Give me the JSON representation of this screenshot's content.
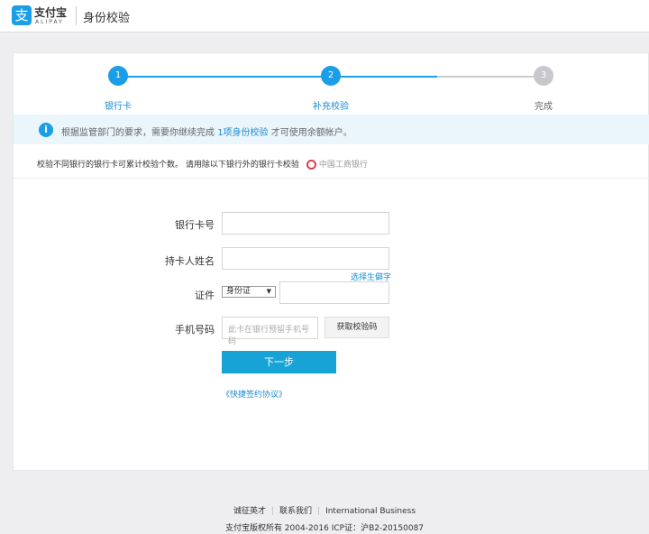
{
  "header": {
    "logo_glyph": "支",
    "logo_name": "支付宝",
    "logo_sub": "ALIPAY",
    "title": "身份校验"
  },
  "steps": [
    {
      "num": "1",
      "label": "银行卡",
      "state": "done"
    },
    {
      "num": "2",
      "label": "补充校验",
      "state": "active"
    },
    {
      "num": "3",
      "label": "完成",
      "state": "todo"
    }
  ],
  "notice": {
    "before": "根据监管部门的要求，需要你继续完成 ",
    "link": "1项身份校验",
    "after": " 才可使用余额帐户。"
  },
  "tip": {
    "text": "校验不同银行的银行卡可累计校验个数。 请用除以下银行外的银行卡校验",
    "bank": "中国工商银行"
  },
  "form": {
    "card_label": "银行卡号",
    "name_label": "持卡人姓名",
    "rare_char_link": "选择生僻字",
    "id_label": "证件",
    "id_type": "身份证",
    "phone_label": "手机号码",
    "phone_placeholder": "此卡在银行预留手机号码",
    "get_code": "获取校验码",
    "next": "下一步",
    "agreement": "《快捷签约协议》"
  },
  "footer": {
    "links": [
      "诚征英才",
      "联系我们",
      "International Business"
    ],
    "copyright": "支付宝版权所有 2004-2016 ICP证：沪B2-20150087"
  },
  "colors": {
    "accent": "#1a9ee8",
    "button": "#18a3d6",
    "inactive": "#c8c8cc"
  }
}
